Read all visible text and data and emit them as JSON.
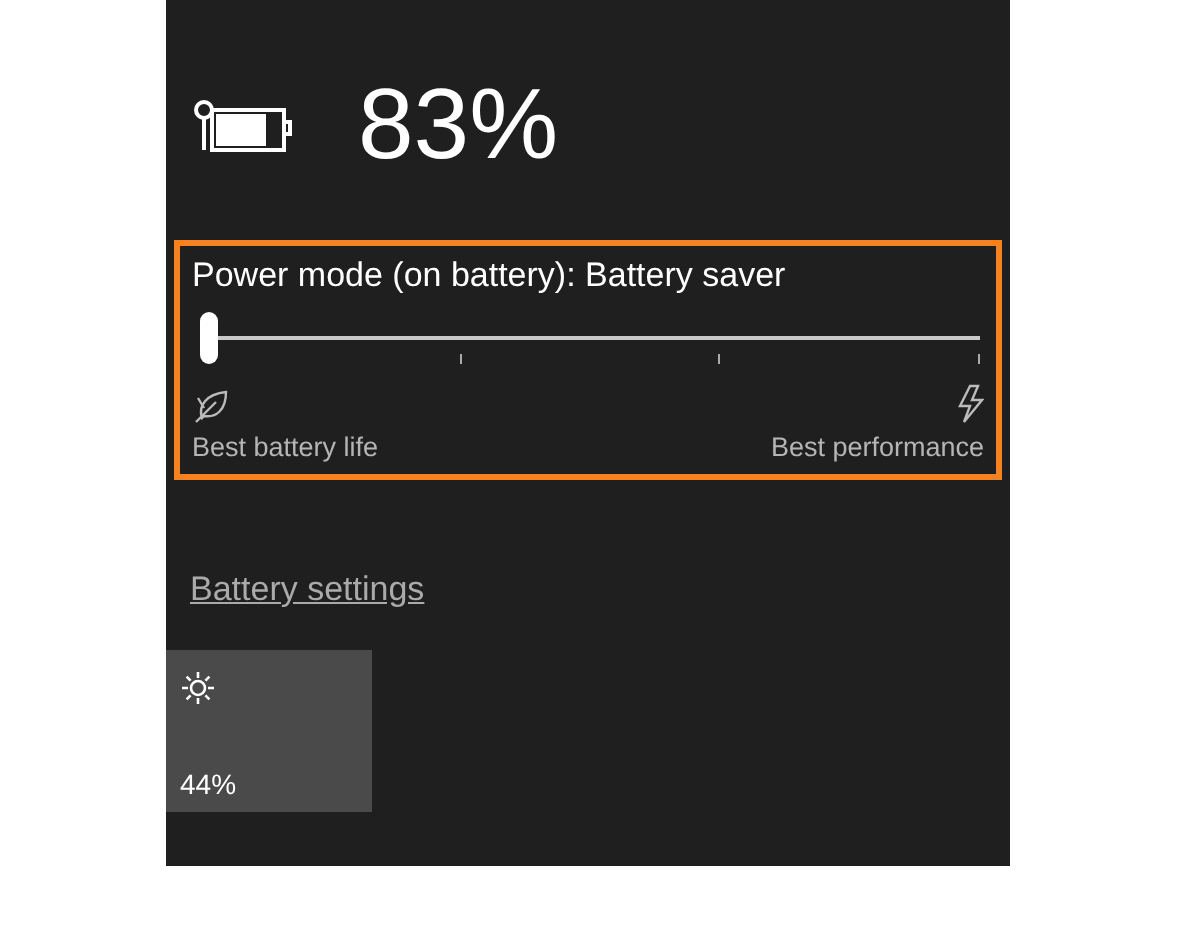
{
  "battery": {
    "percent": "83%"
  },
  "power_mode": {
    "title": "Power mode (on battery): Battery saver",
    "level": 0,
    "highlighted": true,
    "left_label": "Best battery life",
    "right_label": "Best performance"
  },
  "settings_link": "Battery settings",
  "tiles": [
    {
      "kind": "brightness",
      "value": "44%"
    }
  ]
}
